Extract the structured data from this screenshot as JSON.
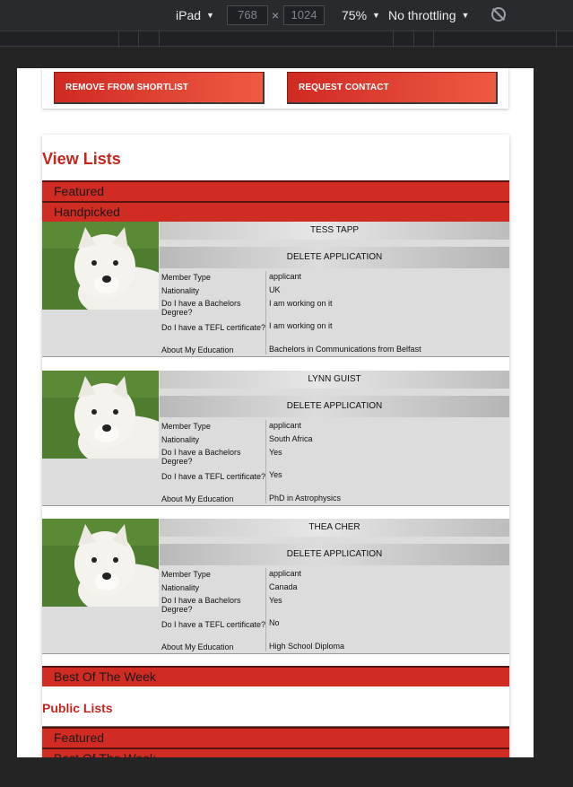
{
  "devtools": {
    "device": "iPad",
    "width": "768",
    "height": "1024",
    "zoom": "75%",
    "throttling": "No throttling"
  },
  "top_buttons": {
    "remove": "REMOVE FROM SHORTLIST",
    "request": "REQUEST CONTACT"
  },
  "view_lists": {
    "title": "View Lists",
    "featured": "Featured",
    "handpicked": "Handpicked",
    "best": "Best Of The Week"
  },
  "labels": {
    "member_type": "Member Type",
    "nationality": "Nationality",
    "bachelors": "Do I have a Bachelors Degree?",
    "tefl": "Do I have a TEFL certificate?",
    "education": "About My Education",
    "delete": "DELETE APPLICATION"
  },
  "applicants": [
    {
      "name": "TESS TAPP",
      "member_type": "applicant",
      "nationality": "UK",
      "bachelors": "I am working on it",
      "tefl": "I am working on it",
      "education": "Bachelors in Communications from Belfast"
    },
    {
      "name": "LYNN GUIST",
      "member_type": "applicant",
      "nationality": "South Africa",
      "bachelors": "Yes",
      "tefl": "Yes",
      "education": "PhD in Astrophysics"
    },
    {
      "name": "THEA CHER",
      "member_type": "applicant",
      "nationality": "Canada",
      "bachelors": "Yes",
      "tefl": "No",
      "education": "High School Diploma"
    }
  ],
  "public_lists": {
    "title": "Public Lists",
    "featured": "Featured",
    "best": "Best Of The Week"
  },
  "colors": {
    "accent_red": "#d12c24",
    "title_red": "#c2261e"
  }
}
